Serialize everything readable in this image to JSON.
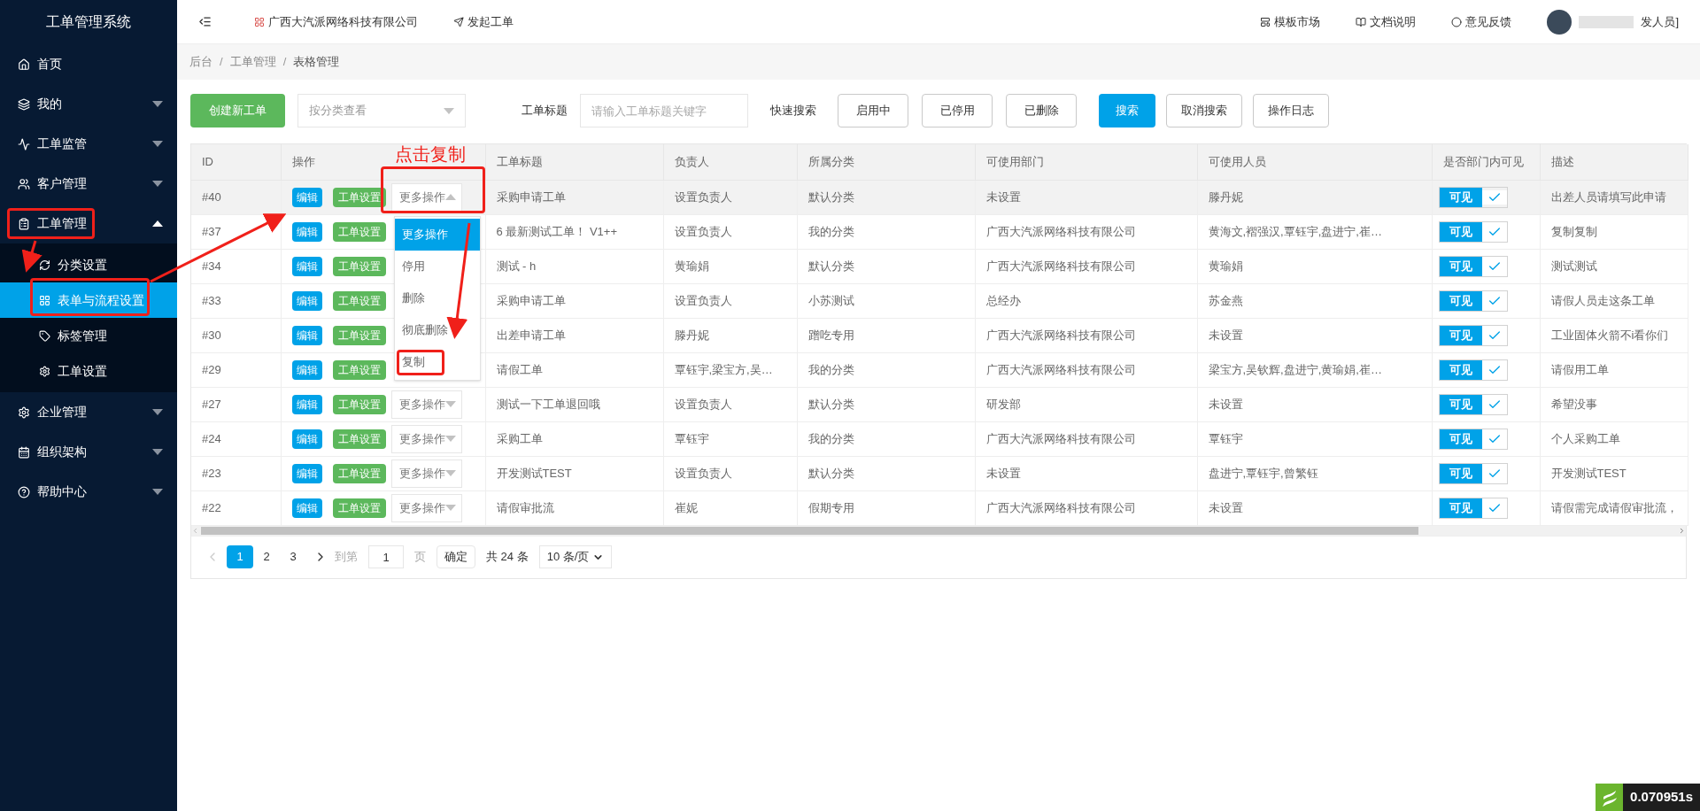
{
  "sidebar": {
    "title": "工单管理系统",
    "items": [
      {
        "label": "首页",
        "kind": "link",
        "selected": false
      },
      {
        "label": "我的",
        "kind": "group",
        "expanded": false,
        "selected": false
      },
      {
        "label": "工单监管",
        "kind": "group",
        "expanded": false,
        "selected": false
      },
      {
        "label": "客户管理",
        "kind": "group",
        "expanded": false,
        "selected": false
      },
      {
        "label": "工单管理",
        "kind": "group",
        "expanded": true,
        "selected": false,
        "children": [
          {
            "label": "分类设置",
            "selected": false
          },
          {
            "label": "表单与流程设置",
            "selected": true
          },
          {
            "label": "标签管理",
            "selected": false
          },
          {
            "label": "工单设置",
            "selected": false
          }
        ]
      },
      {
        "label": "企业管理",
        "kind": "group",
        "expanded": false,
        "selected": false
      },
      {
        "label": "组织架构",
        "kind": "group",
        "expanded": false,
        "selected": false
      },
      {
        "label": "帮助中心",
        "kind": "group",
        "expanded": false,
        "selected": false
      }
    ]
  },
  "topbar": {
    "company": "广西大汽派网络科技有限公司",
    "create_link": "发起工单",
    "links": [
      "模板市场",
      "文档说明",
      "意见反馈"
    ],
    "user": "发人员]"
  },
  "breadcrumb": {
    "items": [
      "后台",
      "工单管理",
      "表格管理"
    ],
    "separator": "/"
  },
  "toolbar": {
    "create_button": "创建新工单",
    "category_select": {
      "placeholder": "按分类查看"
    },
    "title_label": "工单标题",
    "title_input": {
      "placeholder": "请输入工单标题关键字"
    },
    "quick_label": "快速搜索",
    "filters": [
      {
        "label": "启用中",
        "selected": false
      },
      {
        "label": "已停用",
        "selected": false
      },
      {
        "label": "已删除",
        "selected": false
      }
    ],
    "actions": [
      {
        "label": "搜索",
        "kind": "primary"
      },
      {
        "label": "取消搜索",
        "kind": "default"
      },
      {
        "label": "操作日志",
        "kind": "default"
      }
    ]
  },
  "table": {
    "columns": [
      "ID",
      "操作",
      "工单标题",
      "负责人",
      "所属分类",
      "可使用部门",
      "可使用人员",
      "是否部门内可见",
      "描述"
    ],
    "rows": [
      {
        "id": "#40",
        "edit": "编辑",
        "settings": "工单设置",
        "more": "更多操作",
        "more_open": true,
        "title": "采购申请工单",
        "owner": "设置负责人",
        "category": "默认分类",
        "dept": "未设置",
        "users": "滕丹妮",
        "visible_label": "可见",
        "visible": true,
        "description": "出差人员请填写此申请",
        "selected": true
      },
      {
        "id": "#37",
        "edit": "编辑",
        "settings": "工单设置",
        "title": "6 最新测试工单！ V1++",
        "owner": "设置负责人",
        "category": "我的分类",
        "dept": "广西大汽派网络科技有限公司",
        "users": "黄海文,褶强汉,覃钰宇,盘进宁,崔…",
        "visible_label": "可见",
        "visible": true,
        "description": "复制复制",
        "selected": false
      },
      {
        "id": "#34",
        "edit": "编辑",
        "settings": "工单设置",
        "title": "测试 - h",
        "owner": "黄瑜娟",
        "category": "默认分类",
        "dept": "广西大汽派网络科技有限公司",
        "users": "黄瑜娟",
        "visible_label": "可见",
        "visible": true,
        "description": "测试测试",
        "selected": false
      },
      {
        "id": "#33",
        "edit": "编辑",
        "settings": "工单设置",
        "title": "采购申请工单",
        "owner": "设置负责人",
        "category": "小苏测试",
        "dept": "总经办",
        "users": "苏金燕",
        "visible_label": "可见",
        "visible": true,
        "description": "请假人员走这条工单",
        "selected": false
      },
      {
        "id": "#30",
        "edit": "编辑",
        "settings": "工单设置",
        "title": "出差申请工单",
        "owner": "滕丹妮",
        "category": "蹭吃专用",
        "dept": "广西大汽派网络科技有限公司",
        "users": "未设置",
        "visible_label": "可见",
        "visible": true,
        "description": "工业固体火箭不i看你们",
        "selected": false
      },
      {
        "id": "#29",
        "edit": "编辑",
        "settings": "工单设置",
        "title": "请假工单",
        "owner": "覃钰宇,梁宝方,吴…",
        "category": "我的分类",
        "dept": "广西大汽派网络科技有限公司",
        "users": "梁宝方,吴钦辉,盘进宁,黄瑜娟,崔…",
        "visible_label": "可见",
        "visible": true,
        "description": "请假用工单",
        "selected": false
      },
      {
        "id": "#27",
        "edit": "编辑",
        "settings": "工单设置",
        "more": "更多操作",
        "more_open": false,
        "title": "测试一下工单退回哦",
        "owner": "设置负责人",
        "category": "默认分类",
        "dept": "研发部",
        "users": "未设置",
        "visible_label": "可见",
        "visible": true,
        "description": "希望没事",
        "selected": false
      },
      {
        "id": "#24",
        "edit": "编辑",
        "settings": "工单设置",
        "more": "更多操作",
        "more_open": false,
        "title": "采购工单",
        "owner": "覃钰宇",
        "category": "我的分类",
        "dept": "广西大汽派网络科技有限公司",
        "users": "覃钰宇",
        "visible_label": "可见",
        "visible": true,
        "description": "个人采购工单",
        "selected": false
      },
      {
        "id": "#23",
        "edit": "编辑",
        "settings": "工单设置",
        "more": "更多操作",
        "more_open": false,
        "title": "开发测试TEST",
        "owner": "设置负责人",
        "category": "默认分类",
        "dept": "未设置",
        "users": "盘进宁,覃钰宇,曾繁钰",
        "visible_label": "可见",
        "visible": true,
        "description": "开发测试TEST",
        "selected": false
      },
      {
        "id": "#22",
        "edit": "编辑",
        "settings": "工单设置",
        "more": "更多操作",
        "more_open": false,
        "title": "请假审批流",
        "owner": "崔妮",
        "category": "假期专用",
        "dept": "广西大汽派网络科技有限公司",
        "users": "未设置",
        "visible_label": "可见",
        "visible": true,
        "description": "请假需完成请假审批流，",
        "selected": false
      }
    ]
  },
  "more_menu": {
    "items": [
      {
        "label": "更多操作",
        "selected": true
      },
      {
        "label": "停用",
        "selected": false
      },
      {
        "label": "删除",
        "selected": false
      },
      {
        "label": "彻底删除",
        "selected": false
      },
      {
        "label": "复制",
        "selected": false
      }
    ]
  },
  "pagination": {
    "pages": [
      {
        "label": "1",
        "selected": true
      },
      {
        "label": "2",
        "selected": false
      },
      {
        "label": "3",
        "selected": false
      }
    ],
    "goto_label": "到第",
    "goto_value": "1",
    "page_unit": "页",
    "confirm": "确定",
    "total": "共 24 条",
    "page_size": "10 条/页"
  },
  "annotation": {
    "text": "点击复制"
  },
  "timer_badge": "0.070951s"
}
